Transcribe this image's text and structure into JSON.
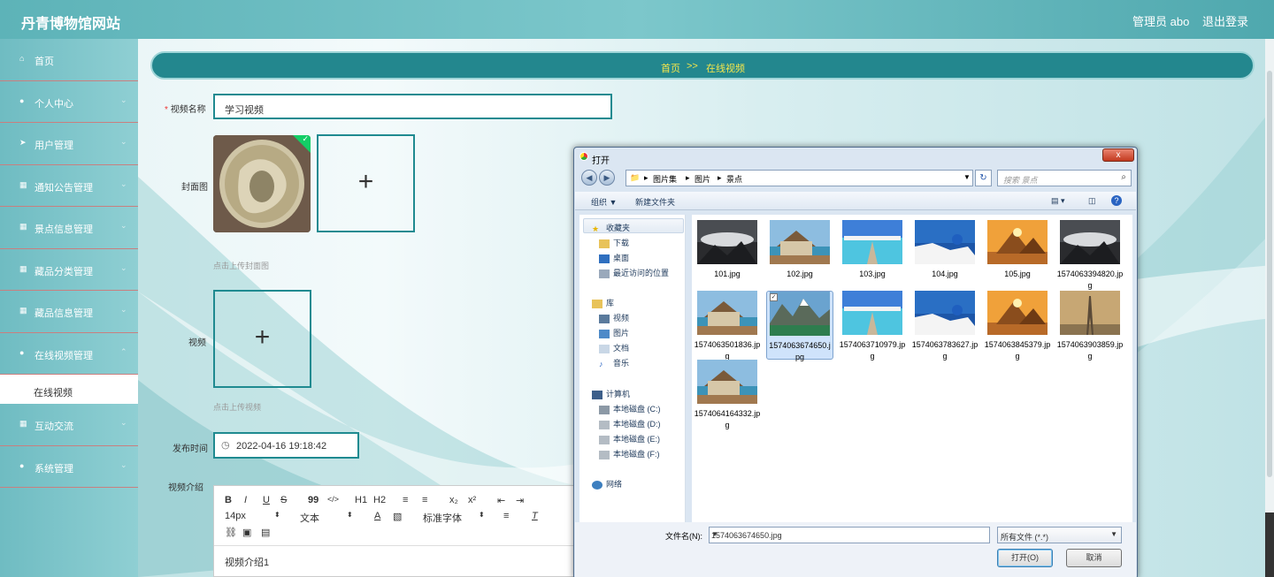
{
  "app": {
    "site_title": "丹青博物馆网站",
    "admin_label": "管理员 abo",
    "logout_label": "退出登录"
  },
  "sidebar": {
    "items": [
      {
        "label": "首页",
        "icon": "home-icon"
      },
      {
        "label": "个人中心",
        "icon": "user-icon"
      },
      {
        "label": "用户管理",
        "icon": "send-icon"
      },
      {
        "label": "通知公告管理",
        "icon": "grid-icon"
      },
      {
        "label": "景点信息管理",
        "icon": "grid-icon"
      },
      {
        "label": "藏品分类管理",
        "icon": "grid-icon"
      },
      {
        "label": "藏品信息管理",
        "icon": "grid-icon"
      },
      {
        "label": "在线视频管理",
        "icon": "user-icon"
      },
      {
        "label": "互动交流",
        "icon": "grid-icon"
      },
      {
        "label": "系统管理",
        "icon": "pin-icon"
      }
    ],
    "sub_item": "在线视频"
  },
  "breadcrumb": {
    "home": "首页",
    "sep": ">>",
    "current": "在线视频"
  },
  "form": {
    "name_label": "视频名称",
    "name_value": "学习视频",
    "cover_label": "封面图",
    "cover_hint": "点击上传封面图",
    "video_label": "视频",
    "video_hint": "点击上传视频",
    "date_label": "发布时间",
    "date_value": "2022-04-16 19:18:42",
    "intro_label": "视频介绍",
    "intro_value": "视频介绍1"
  },
  "editor": {
    "toolbar_row1": [
      "B",
      "I",
      "U",
      "S",
      "99",
      "</>",
      "H1",
      "H2",
      "≡",
      "≡",
      "x₂",
      "x²",
      "⇤",
      "⇥"
    ],
    "font_size": "14px",
    "para": "文本",
    "font_family": "标准字体"
  },
  "dialog": {
    "title": "打开",
    "close": "x",
    "path": [
      "图片集",
      "图片",
      "景点"
    ],
    "search_placeholder": "搜索 景点",
    "organize": "组织 ▼",
    "new_folder": "新建文件夹",
    "nav": {
      "favorites": "收藏夹",
      "downloads": "下载",
      "desktop": "桌面",
      "recent": "最近访问的位置",
      "libraries": "库",
      "videos": "视频",
      "pictures": "图片",
      "documents": "文档",
      "music": "音乐",
      "computer": "计算机",
      "disk_c": "本地磁盘 (C:)",
      "disk_d": "本地磁盘 (D:)",
      "disk_e": "本地磁盘 (E:)",
      "disk_f": "本地磁盘 (F:)",
      "network": "网络"
    },
    "files": [
      {
        "name": "101.jpg",
        "scene": "cloud"
      },
      {
        "name": "102.jpg",
        "scene": "house"
      },
      {
        "name": "103.jpg",
        "scene": "pier"
      },
      {
        "name": "104.jpg",
        "scene": "santorini"
      },
      {
        "name": "105.jpg",
        "scene": "pyramid"
      },
      {
        "name": "1574063394820.jpg",
        "scene": "cloud"
      },
      {
        "name": "1574063501836.jpg",
        "scene": "house"
      },
      {
        "name": "1574063674650.jpg",
        "scene": "mountain",
        "selected": true
      },
      {
        "name": "1574063710979.jpg",
        "scene": "pier"
      },
      {
        "name": "1574063783627.jpg",
        "scene": "santorini"
      },
      {
        "name": "1574063845379.jpg",
        "scene": "pyramid"
      },
      {
        "name": "1574063903859.jpg",
        "scene": "eiffel"
      },
      {
        "name": "1574064164332.jpg",
        "scene": "house"
      }
    ],
    "filename_label": "文件名(N):",
    "filename_value": "1574063674650.jpg",
    "filetype": "所有文件 (*.*)",
    "open_button": "打开(O)",
    "cancel_button": "取消"
  },
  "colors": {
    "accent": "#1f8a90",
    "breadcrumb_text": "#f5e64b",
    "sidebar": "#7cc7cb"
  }
}
